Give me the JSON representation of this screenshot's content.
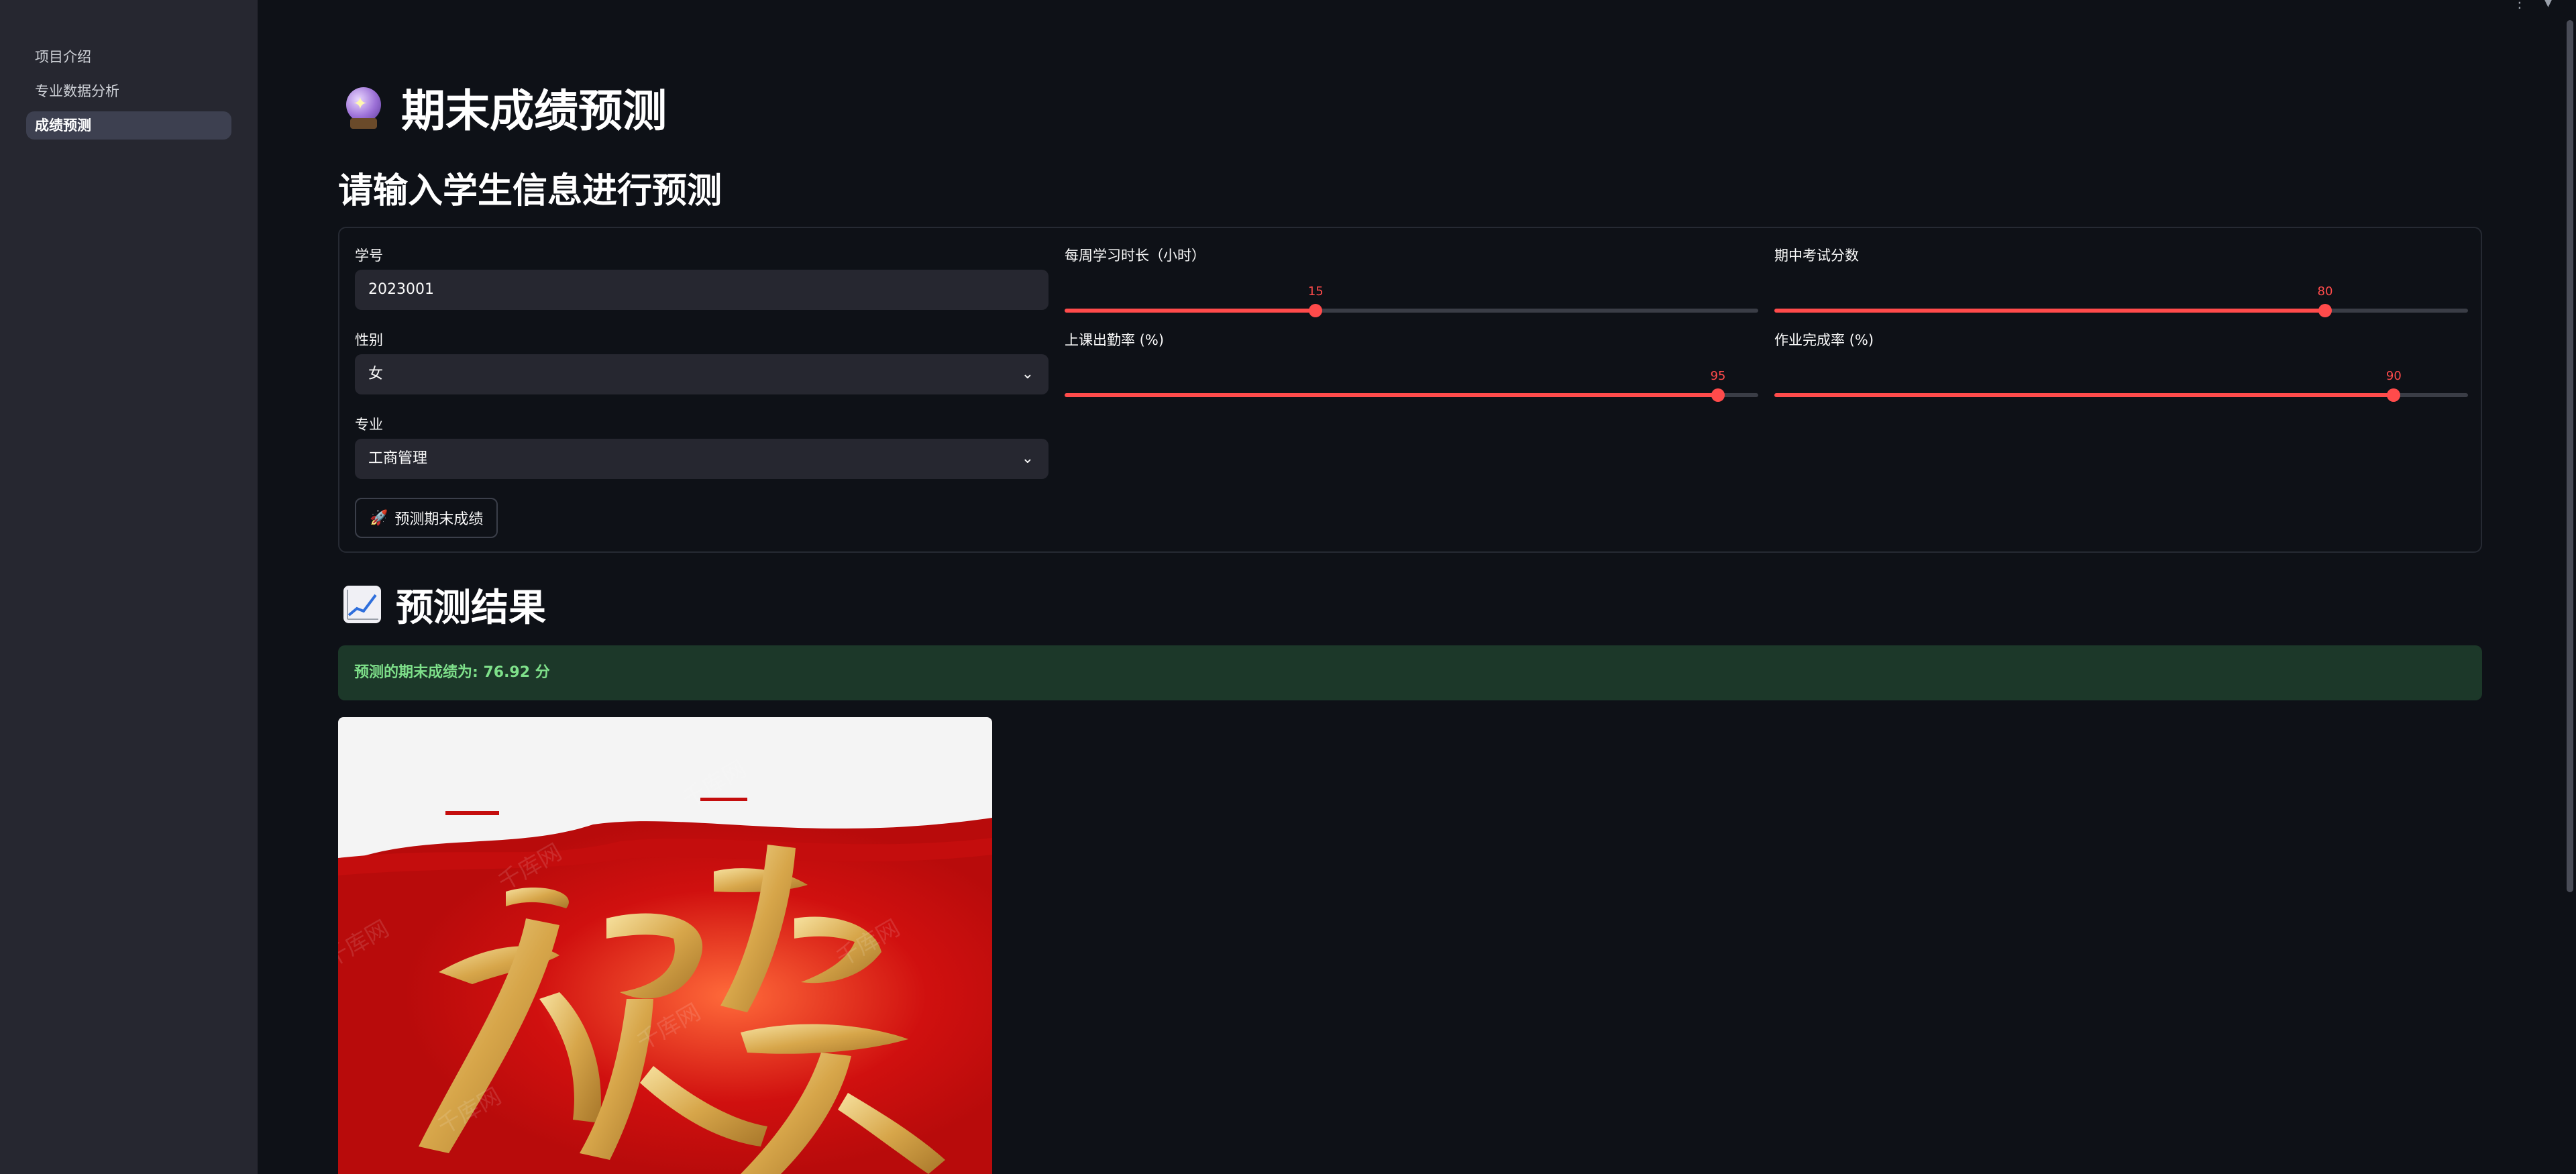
{
  "sidebar": {
    "items": [
      {
        "label": "项目介绍",
        "active": false
      },
      {
        "label": "专业数据分析",
        "active": false
      },
      {
        "label": "成绩预测",
        "active": true
      }
    ]
  },
  "page": {
    "title": "期末成绩预测",
    "title_icon": "crystal-ball-icon",
    "subtitle": "请输入学生信息进行预测"
  },
  "form": {
    "student_id": {
      "label": "学号",
      "value": "2023001"
    },
    "gender": {
      "label": "性别",
      "value": "女"
    },
    "major": {
      "label": "专业",
      "value": "工商管理"
    },
    "study_hours": {
      "label": "每周学习时长（小时）",
      "value": 15,
      "display": "15",
      "fraction": 0.362
    },
    "attendance": {
      "label": "上课出勤率 (%)",
      "value": 95,
      "display": "95",
      "fraction": 0.942
    },
    "midterm": {
      "label": "期中考试分数",
      "value": 80,
      "display": "80",
      "fraction": 0.794
    },
    "homework": {
      "label": "作业完成率 (%)",
      "value": 90,
      "display": "90",
      "fraction": 0.893
    },
    "submit_label": "预测期末成绩",
    "submit_icon": "rocket-icon"
  },
  "result": {
    "title": "预测结果",
    "title_icon": "chart-increasing-icon",
    "message": "预测的期末成绩为: 76.92 分",
    "image_text": "祝贺",
    "watermark": "千库网"
  },
  "colors": {
    "accent": "#ff4b4b",
    "success_bg": "#1c3829",
    "success_text": "#7ee08a",
    "sidebar_bg": "#262730",
    "main_bg": "#0e1117"
  }
}
